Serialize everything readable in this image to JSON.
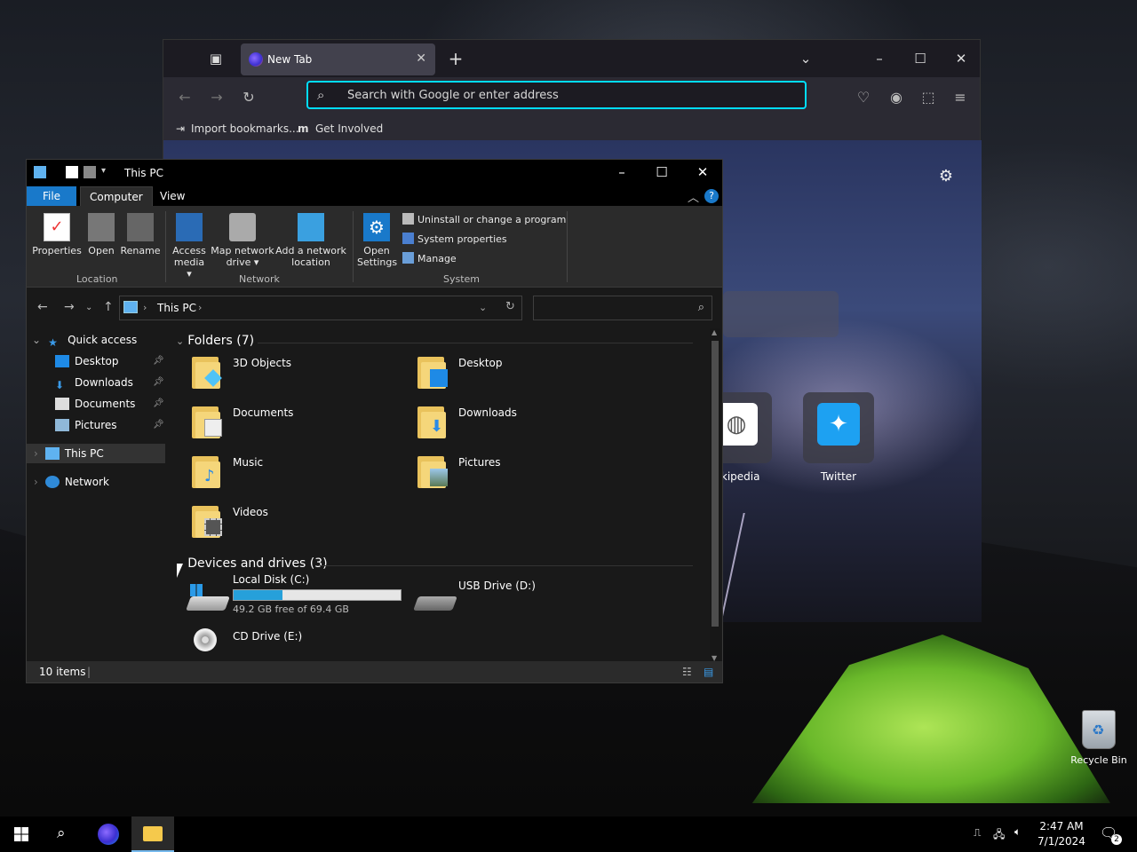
{
  "browser": {
    "tab_title": "New Tab",
    "url_placeholder": "Search with Google or enter address",
    "bookmarks": [
      {
        "label": "Import bookmarks..."
      },
      {
        "label": "Get Involved"
      }
    ],
    "shortcuts": [
      {
        "label": "ikipedia"
      },
      {
        "label": "Twitter"
      }
    ]
  },
  "explorer": {
    "title": "This PC",
    "tabs": {
      "file": "File",
      "computer": "Computer",
      "view": "View"
    },
    "ribbon": {
      "buttons": {
        "properties": "Properties",
        "open": "Open",
        "rename": "Rename",
        "access_media_1": "Access",
        "access_media_2": "media ▾",
        "map_drive_1": "Map network",
        "map_drive_2": "drive ▾",
        "add_location_1": "Add a network",
        "add_location_2": "location",
        "open_settings_1": "Open",
        "open_settings_2": "Settings"
      },
      "system_items": {
        "uninstall": "Uninstall or change a program",
        "system_properties": "System properties",
        "manage": "Manage"
      },
      "groups": {
        "location": "Location",
        "network": "Network",
        "system": "System"
      }
    },
    "address": {
      "crumb": "This PC"
    },
    "nav": {
      "quick_access": "Quick access",
      "desktop": "Desktop",
      "downloads": "Downloads",
      "documents": "Documents",
      "pictures": "Pictures",
      "this_pc": "This PC",
      "network": "Network"
    },
    "groups": {
      "folders": "Folders (7)",
      "devices": "Devices and drives (3)"
    },
    "folders": {
      "objects3d": "3D Objects",
      "desktop": "Desktop",
      "documents": "Documents",
      "downloads": "Downloads",
      "music": "Music",
      "pictures": "Pictures",
      "videos": "Videos"
    },
    "drives": {
      "c_name": "Local Disk (C:)",
      "c_free": "49.2 GB free of 69.4 GB",
      "c_used_fraction": 0.29,
      "d_name": "USB Drive (D:)",
      "e_name": "CD Drive (E:)"
    },
    "status": "10 items"
  },
  "desktop": {
    "recycle_bin": "Recycle Bin"
  },
  "taskbar": {
    "time": "2:47 AM",
    "date": "7/1/2024",
    "notif_count": "2"
  },
  "colors": {
    "accent": "#1979ca",
    "url_focus": "#00ddff",
    "drive_bar": "#26a0da"
  }
}
